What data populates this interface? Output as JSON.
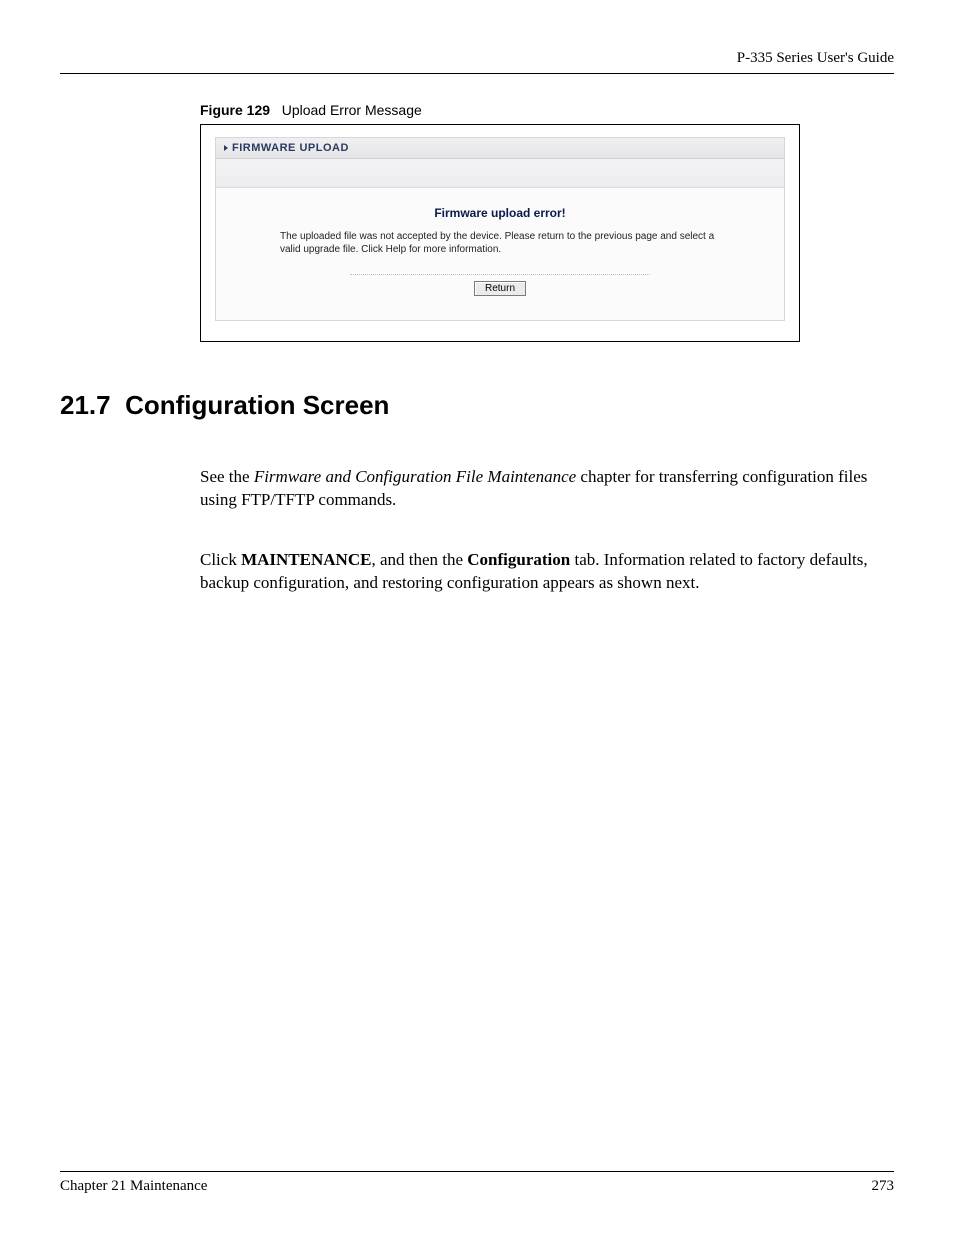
{
  "header": {
    "guide": "P-335 Series User's Guide"
  },
  "figure": {
    "label": "Figure 129",
    "caption": "Upload Error Message",
    "panel_title": "FIRMWARE UPLOAD",
    "error_heading": "Firmware upload error!",
    "error_text": "The uploaded file was not accepted by the device. Please return to the previous page and select a valid upgrade file. Click Help for more information.",
    "return_button": "Return"
  },
  "section": {
    "number": "21.7",
    "title": "Configuration Screen",
    "para1_pre": "See the ",
    "para1_em": "Firmware and Configuration File Maintenance",
    "para1_post": " chapter for transferring configuration files using FTP/TFTP commands.",
    "para2_pre": "Click ",
    "para2_b1": "MAINTENANCE",
    "para2_mid": ", and then the ",
    "para2_b2": "Configuration",
    "para2_post": " tab. Information related to factory defaults, backup configuration, and restoring configuration appears as shown next."
  },
  "footer": {
    "chapter": "Chapter 21 Maintenance",
    "page": "273"
  }
}
